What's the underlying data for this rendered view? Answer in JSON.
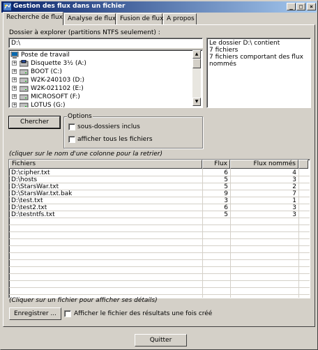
{
  "window": {
    "title": "Gestion des flux dans un fichier"
  },
  "title_buttons": {
    "minimize": "_",
    "maximize": "□",
    "close": "×"
  },
  "tabs": [
    {
      "label": "Recherche de flux",
      "active": true
    },
    {
      "label": "Analyse de flux",
      "active": false
    },
    {
      "label": "Fusion de flux",
      "active": false
    },
    {
      "label": "A propos",
      "active": false
    }
  ],
  "search": {
    "folder_label": "Dossier à explorer (partitions NTFS seulement) :",
    "folder_value": "D:\\",
    "tree": [
      {
        "label": "Poste de travail",
        "icon": "computer-icon"
      },
      {
        "label": "Disquette 3½ (A:)",
        "icon": "floppy-drive-icon"
      },
      {
        "label": "BOOT (C:)",
        "icon": "hard-drive-icon"
      },
      {
        "label": "W2K-240103 (D:)",
        "icon": "hard-drive-icon"
      },
      {
        "label": "W2K-021102 (E:)",
        "icon": "hard-drive-icon"
      },
      {
        "label": "MICROSOFT (F:)",
        "icon": "hard-drive-icon"
      },
      {
        "label": "LOTUS (G:)",
        "icon": "hard-drive-icon"
      }
    ],
    "info_lines": [
      "Le dossier D:\\ contient",
      "7 fichiers",
      "7 fichiers comportant des flux",
      "nommés"
    ],
    "search_button": "Chercher",
    "options_title": "Options",
    "opt_subfolders": "sous-dossiers inclus",
    "opt_all_files": "afficher tous les fichiers",
    "sort_hint": "(cliquer sur le nom d'une colonne pour la retrier)",
    "columns": {
      "file": "Fichiers",
      "flux": "Flux",
      "named": "Flux nommés"
    },
    "rows": [
      {
        "file": "D:\\cipher.txt",
        "flux": "6",
        "named": "4"
      },
      {
        "file": "D:\\hosts",
        "flux": "5",
        "named": "3"
      },
      {
        "file": "D:\\StarsWar.txt",
        "flux": "5",
        "named": "2"
      },
      {
        "file": "D:\\StarsWar.txt.bak",
        "flux": "9",
        "named": "7"
      },
      {
        "file": "D:\\test.txt",
        "flux": "3",
        "named": "1"
      },
      {
        "file": "D:\\test2.txt",
        "flux": "6",
        "named": "3"
      },
      {
        "file": "D:\\testntfs.txt",
        "flux": "5",
        "named": "3"
      }
    ],
    "details_hint": "(Cliquer sur un fichier pour afficher ses détails)",
    "save_button": "Enregistrer ...",
    "show_results_label": "Afficher le fichier des résultats une fois créé"
  },
  "quit_button": "Quitter"
}
